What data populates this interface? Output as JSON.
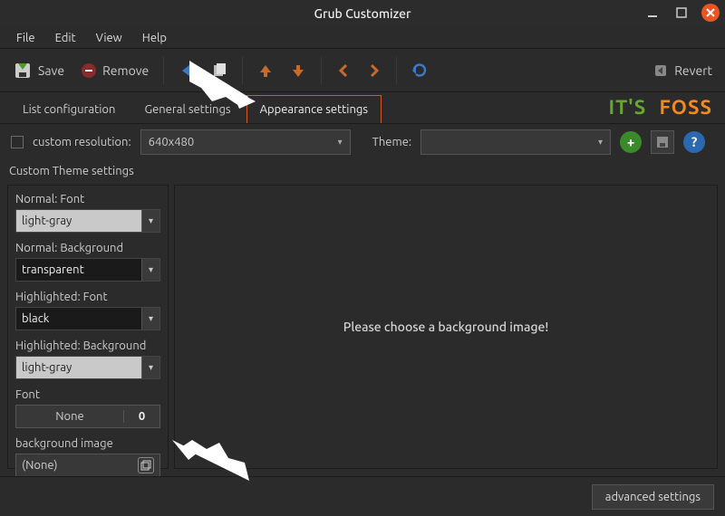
{
  "window": {
    "title": "Grub Customizer"
  },
  "menubar": {
    "items": [
      "File",
      "Edit",
      "View",
      "Help"
    ]
  },
  "toolbar": {
    "save_label": "Save",
    "remove_label": "Remove",
    "revert_label": "Revert"
  },
  "tabs": {
    "items": [
      {
        "label": "List configuration",
        "active": false
      },
      {
        "label": "General settings",
        "active": false
      },
      {
        "label": "Appearance settings",
        "active": true
      }
    ]
  },
  "logo": {
    "part1": "IT'S",
    "part2": "FOSS"
  },
  "options": {
    "custom_resolution_label": "custom resolution:",
    "resolution_value": "640x480",
    "theme_label": "Theme:",
    "theme_value": ""
  },
  "section_header": "Custom Theme settings",
  "side": {
    "normal_font_label": "Normal: Font",
    "normal_font_value": "light-gray",
    "normal_bg_label": "Normal: Background",
    "normal_bg_value": "transparent",
    "hi_font_label": "Highlighted: Font",
    "hi_font_value": "black",
    "hi_bg_label": "Highlighted: Background",
    "hi_bg_value": "light-gray",
    "font_label": "Font",
    "font_name": "None",
    "font_size": "0",
    "bg_label": "background image",
    "bg_value": "(None)"
  },
  "preview": {
    "text": "Please choose a background image!"
  },
  "footer": {
    "advanced_label": "advanced settings"
  }
}
